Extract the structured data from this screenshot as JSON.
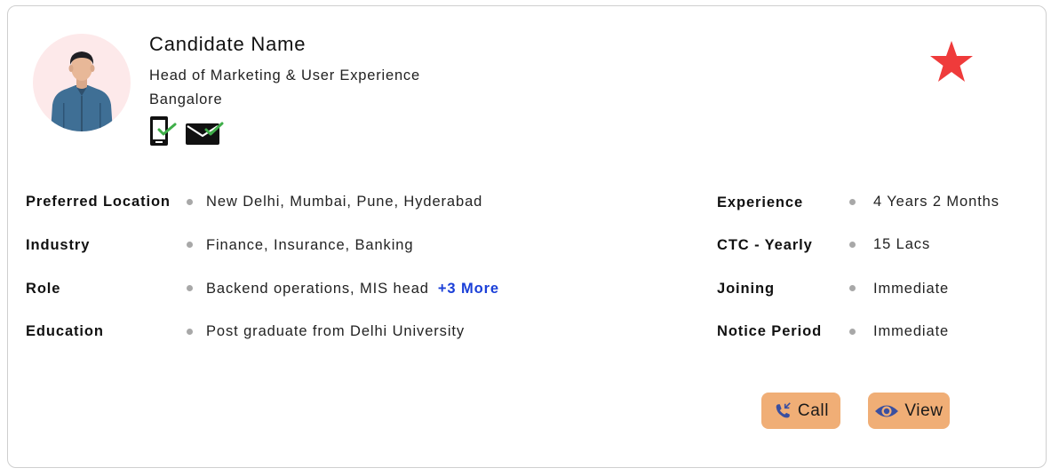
{
  "candidate": {
    "name": "Candidate Name",
    "title": "Head of Marketing & User Experience",
    "location": "Bangalore"
  },
  "details_left": [
    {
      "label": "Preferred Location",
      "value": "New Delhi, Mumbai, Pune, Hyderabad"
    },
    {
      "label": "Industry",
      "value": "Finance, Insurance, Banking"
    },
    {
      "label": "Role",
      "value": "Backend operations, MIS head",
      "more": "+3 More"
    },
    {
      "label": "Education",
      "value": "Post graduate from Delhi University"
    }
  ],
  "details_right": [
    {
      "label": "Experience",
      "value": "4 Years 2 Months"
    },
    {
      "label": "CTC - Yearly",
      "value": "15 Lacs"
    },
    {
      "label": "Joining",
      "value": "Immediate"
    },
    {
      "label": "Notice Period",
      "value": "Immediate"
    }
  ],
  "actions": {
    "call_label": "Call",
    "view_label": "View"
  },
  "icons": {
    "favorite": "star-icon",
    "phone_verified": "mobile-verified-icon",
    "email_verified": "email-verified-icon",
    "call": "phone-call-icon",
    "view": "eye-icon"
  },
  "colors": {
    "star": "#ef3b3b",
    "button_bg": "#f0ae76",
    "more_link": "#1a3fd8",
    "verified_check": "#3fae49",
    "avatar_bg": "#fde9ea"
  }
}
